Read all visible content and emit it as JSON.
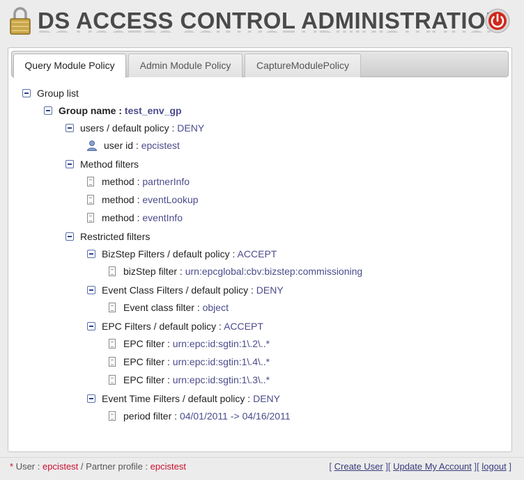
{
  "header": {
    "title": "DS ACCESS CONTROL ADMINISTRATION",
    "lock_icon": "lock-icon",
    "power_icon": "power-icon"
  },
  "tabs": [
    {
      "label": "Query Module Policy",
      "active": true
    },
    {
      "label": "Admin Module Policy",
      "active": false
    },
    {
      "label": "CaptureModulePolicy",
      "active": false
    }
  ],
  "tree": {
    "group_list_label": "Group list",
    "group_name_label": "Group name :",
    "group_name_value": "test_env_gp",
    "users_label": "users / default policy :",
    "users_policy": "DENY",
    "user_id_label": "user id :",
    "user_id_value": "epcistest",
    "method_filters_label": "Method filters",
    "methods": [
      {
        "label": "method :",
        "value": "partnerInfo"
      },
      {
        "label": "method :",
        "value": "eventLookup"
      },
      {
        "label": "method :",
        "value": "eventInfo"
      }
    ],
    "restricted_filters_label": "Restricted filters",
    "bizstep": {
      "label": "BizStep Filters / default policy :",
      "policy": "ACCEPT",
      "items": [
        {
          "label": "bizStep filter :",
          "value": "urn:epcglobal:cbv:bizstep:commissioning"
        }
      ]
    },
    "event_class": {
      "label": "Event Class Filters / default policy :",
      "policy": "DENY",
      "items": [
        {
          "label": "Event class filter :",
          "value": "object"
        }
      ]
    },
    "epc": {
      "label": "EPC Filters / default policy :",
      "policy": "ACCEPT",
      "items": [
        {
          "label": "EPC filter :",
          "value": "urn:epc:id:sgtin:1\\.2\\..*"
        },
        {
          "label": "EPC filter :",
          "value": "urn:epc:id:sgtin:1\\.4\\..*"
        },
        {
          "label": "EPC filter :",
          "value": "urn:epc:id:sgtin:1\\.3\\..*"
        }
      ]
    },
    "event_time": {
      "label": "Event Time Filters / default policy :",
      "policy": "DENY",
      "items": [
        {
          "label": "period filter :",
          "value": "04/01/2011 -> 04/16/2011"
        }
      ]
    }
  },
  "footer": {
    "asterisk": "*",
    "user_label": "User :",
    "user_value": "epcistest",
    "partner_label": "/ Partner profile :",
    "partner_value": "epcistest",
    "links": [
      "Create User",
      "Update My Account",
      "logout"
    ],
    "link_color": "#3a3a7a"
  },
  "colors": {
    "value_text": "#4b4b8c",
    "footer_red": "#c8102e",
    "power_red": "#d0281b"
  }
}
